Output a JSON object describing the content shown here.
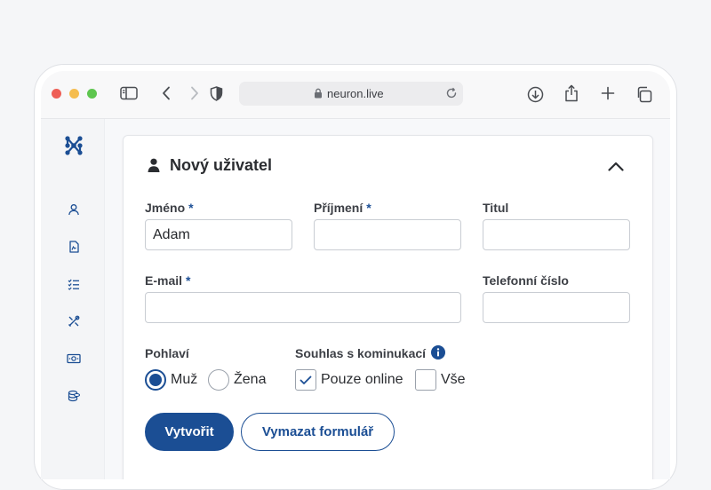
{
  "browser": {
    "url": "neuron.live"
  },
  "colors": {
    "primary": "#1b4e94",
    "traffic_red": "#ee5f57",
    "traffic_yellow": "#f5bd4f",
    "traffic_green": "#5ec64f"
  },
  "sidebar": {
    "items": [
      {
        "icon": "user-icon"
      },
      {
        "icon": "document-icon"
      },
      {
        "icon": "checklist-icon"
      },
      {
        "icon": "tools-icon"
      },
      {
        "icon": "money-icon"
      },
      {
        "icon": "coins-icon"
      }
    ]
  },
  "form": {
    "title": "Nový uživatel",
    "required_mark": "*",
    "first_name": {
      "label": "Jméno",
      "value": "Adam"
    },
    "last_name": {
      "label": "Příjmení",
      "value": ""
    },
    "title_field": {
      "label": "Titul",
      "value": ""
    },
    "email": {
      "label": "E-mail",
      "value": ""
    },
    "phone": {
      "label": "Telefonní číslo",
      "value": ""
    },
    "gender": {
      "label": "Pohlaví",
      "options": [
        {
          "label": "Muž",
          "selected": true
        },
        {
          "label": "Žena",
          "selected": false
        }
      ]
    },
    "consent": {
      "label": "Souhlas s kominukací",
      "options": [
        {
          "label": "Pouze online",
          "checked": true
        },
        {
          "label": "Vše",
          "checked": false
        }
      ]
    },
    "create_label": "Vytvořit",
    "clear_label": "Vymazat formulář"
  }
}
